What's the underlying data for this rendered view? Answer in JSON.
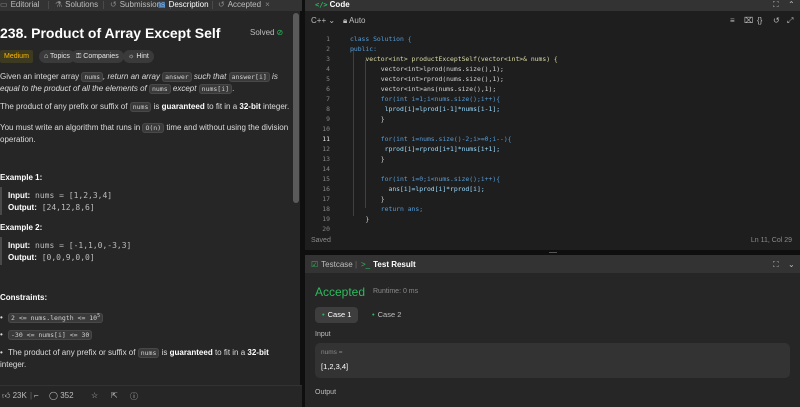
{
  "left": {
    "tabs": [
      {
        "icon": "▭",
        "label": "Editorial"
      },
      {
        "icon": "⚗",
        "label": "Solutions"
      },
      {
        "icon": "↺",
        "label": "Submissions"
      },
      {
        "icon": "▤",
        "label": "Description"
      },
      {
        "icon": "↺",
        "label": "Accepted"
      }
    ],
    "title": "238. Product of Array Except Self",
    "solved_label": "Solved",
    "chips": {
      "difficulty": "Medium",
      "topics": "Topics",
      "companies": "Companies",
      "hint": "Hint"
    },
    "desc": {
      "p1": {
        "a": "Given an integer array ",
        "c1": "nums",
        "b": ", return an array ",
        "c2": "answer",
        "c": " such that ",
        "c3": "answer[i]",
        "d": " is equal to the product of all the elements of ",
        "c4": "nums",
        "e": " except ",
        "c5": "nums[i]",
        "f": "."
      },
      "p2": {
        "a": "The product of any prefix or suffix of ",
        "c1": "nums",
        "b": " is ",
        "g1": "guaranteed",
        "c": " to fit in a ",
        "g2": "32-bit",
        "d": " integer."
      },
      "p3": {
        "a": "You must write an algorithm that runs in ",
        "c1": "O(n)",
        "b": " time and without using the division operation."
      }
    },
    "examples": [
      {
        "heading": "Example 1:",
        "input_label": "Input:",
        "input": "nums = [1,2,3,4]",
        "output_label": "Output:",
        "output": "[24,12,8,6]"
      },
      {
        "heading": "Example 2:",
        "input_label": "Input:",
        "input": "nums = [-1,1,0,-3,3]",
        "output_label": "Output:",
        "output": "[0,0,9,0,0]"
      }
    ],
    "constraints": {
      "heading": "Constraints:",
      "c1": "2 <= nums.length <= 10",
      "c1_exp": "5",
      "c2": "-30 <= nums[i] <= 30",
      "c3": {
        "a": "The product of any prefix or suffix of ",
        "c1": "nums",
        "b": " is ",
        "g1": "guaranteed",
        "c": " to fit in a ",
        "g2": "32-bit",
        "d": " integer."
      }
    },
    "bottom": {
      "likes": "23K",
      "dislikes": "352"
    }
  },
  "code": {
    "title": "Code",
    "language": "C++",
    "autosave": "Auto",
    "lines": [
      "class Solution {",
      "public:",
      "    vector<int> productExceptSelf(vector<int>& nums) {",
      "        vector<int>lprod(nums.size(),1);",
      "        vector<int>rprod(nums.size(),1);",
      "        vector<int>ans(nums.size(),1);",
      "        for(int i=1;i<nums.size();i++){",
      "         lprod[i]=lprod[i-1]*nums[i-1];",
      "        }",
      "",
      "        for(int i=nums.size()-2;i>=0;i--){",
      "         rprod[i]=rprod[i+1]*nums[i+1];",
      "        }",
      "",
      "        for(int i=0;i<nums.size();i++){",
      "          ans[i]=lprod[i]*rprod[i];",
      "        }",
      "        return ans;",
      "    }",
      ""
    ],
    "status_left": "Saved",
    "status_right": "Ln 11, Col 29"
  },
  "test": {
    "tab1": "Testcase",
    "tab2": "Test Result",
    "verdict": "Accepted",
    "runtime": "Runtime: 0 ms",
    "cases": [
      "Case 1",
      "Case 2"
    ],
    "input_label": "Input",
    "input_name": "nums =",
    "input_value": "[1,2,3,4]",
    "output_label": "Output"
  },
  "colors": {
    "accent_green": "#2cbb5d",
    "medium": "#ffb800",
    "link_blue": "#4a9eff"
  }
}
